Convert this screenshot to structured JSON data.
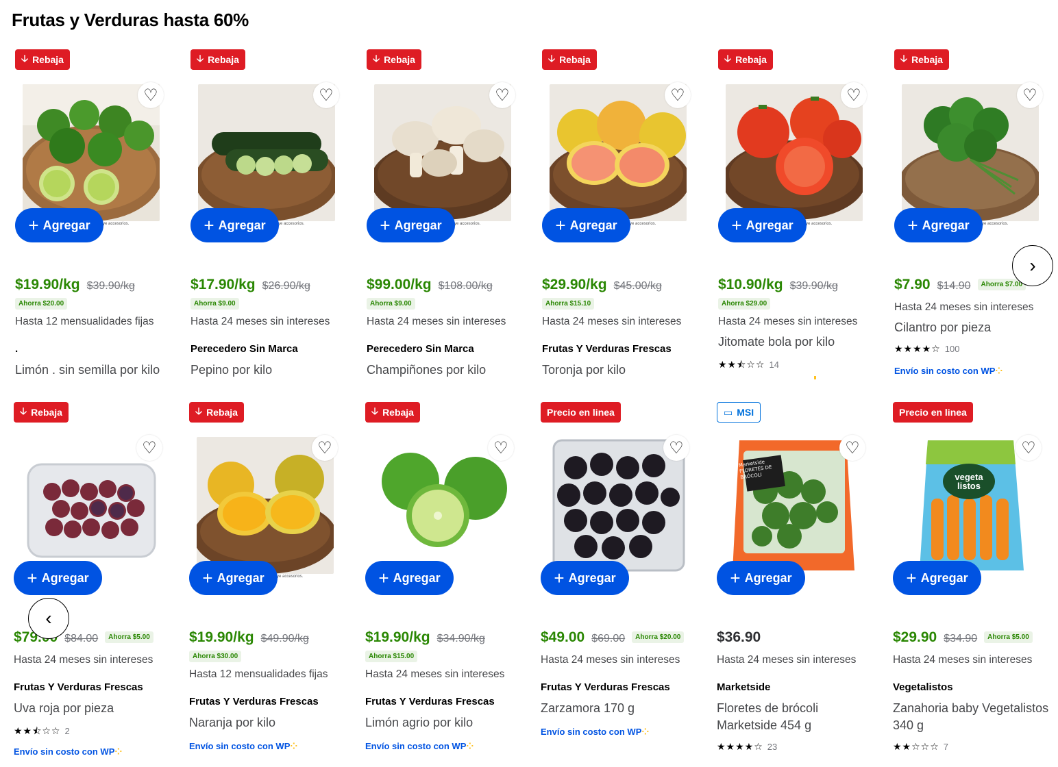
{
  "page_title": "Frutas y Verduras hasta 60%",
  "add_label": "Agregar",
  "favorite_icon": "heart-icon",
  "nav": {
    "next_icon": "chevron-right-icon",
    "prev_icon": "chevron-left-icon"
  },
  "colors": {
    "price_green": "#2a8703",
    "add_blue": "#0053e2",
    "badge_red": "#de1c24"
  },
  "img_text": "ye accesorios.",
  "row1": [
    {
      "badge": "Rebaja",
      "price": "$19.90/kg",
      "old": "$39.90/kg",
      "save": "Ahorra $20.00",
      "msi": "Hasta 12 mensualidades fijas",
      "brand": ".",
      "name": "Limón . sin semilla por kilo"
    },
    {
      "badge": "Rebaja",
      "price": "$17.90/kg",
      "old": "$26.90/kg",
      "save": "Ahorra $9.00",
      "msi": "Hasta 24 meses sin intereses",
      "brand": "Perecedero Sin Marca",
      "name": "Pepino por kilo"
    },
    {
      "badge": "Rebaja",
      "price": "$99.00/kg",
      "old": "$108.00/kg",
      "save": "Ahorra $9.00",
      "msi": "Hasta 24 meses sin intereses",
      "brand": "Perecedero Sin Marca",
      "name": "Champiñones por kilo"
    },
    {
      "badge": "Rebaja",
      "price": "$29.90/kg",
      "old": "$45.00/kg",
      "save": "Ahorra $15.10",
      "msi": "Hasta 24 meses sin intereses",
      "brand": "Frutas Y Verduras Frescas",
      "name": "Toronja por kilo"
    },
    {
      "badge": "Rebaja",
      "price": "$10.90/kg",
      "old": "$39.90/kg",
      "save": "Ahorra $29.00",
      "msi": "Hasta 24 meses sin intereses",
      "name": "Jitomate bola por kilo",
      "stars": "★★⯪☆☆",
      "rating_count": "14"
    },
    {
      "badge": "Rebaja",
      "price": "$7.90",
      "old": "$14.90",
      "save": "Ahorra $7.00",
      "msi": "Hasta 24 meses sin intereses",
      "name": "Cilantro por pieza",
      "stars": "★★★★☆",
      "rating_count": "100",
      "ship": "Envío sin costo con",
      "ship_logo": "WP"
    }
  ],
  "row2": [
    {
      "badge": "Rebaja",
      "price": "$79.00",
      "old": "$84.00",
      "save": "Ahorra $5.00",
      "msi": "Hasta 24 meses sin intereses",
      "brand": "Frutas Y Verduras Frescas",
      "name": "Uva roja por pieza",
      "stars": "★★⯪☆☆",
      "rating_count": "2",
      "ship": "Envío sin costo con",
      "ship_logo": "WP"
    },
    {
      "badge": "Rebaja",
      "price": "$19.90/kg",
      "old": "$49.90/kg",
      "save": "Ahorra $30.00",
      "msi": "Hasta 12 mensualidades fijas",
      "brand": "Frutas Y Verduras Frescas",
      "name": "Naranja por kilo",
      "ship": "Envío sin costo con",
      "ship_logo": "WP"
    },
    {
      "badge": "Rebaja",
      "price": "$19.90/kg",
      "old": "$34.90/kg",
      "save": "Ahorra $15.00",
      "msi": "Hasta 24 meses sin intereses",
      "brand": "Frutas Y Verduras Frescas",
      "name": "Limón agrio por kilo",
      "ship": "Envío sin costo con",
      "ship_logo": "WP"
    },
    {
      "badge": "Precio en linea",
      "price": "$49.00",
      "old": "$69.00",
      "save": "Ahorra $20.00",
      "msi": "Hasta 24 meses sin intereses",
      "brand": "Frutas Y Verduras Frescas",
      "name": "Zarzamora 170 g",
      "ship": "Envío sin costo con",
      "ship_logo": "WP"
    },
    {
      "badge": "MSI",
      "price": "$36.90",
      "msi": "Hasta 24 meses sin intereses",
      "brand": "Marketside",
      "name": "Floretes de brócoli Marketside 454 g",
      "stars": "★★★★☆",
      "rating_count": "23",
      "pack_text": "Marketside FLORETES DE BRÓCOLI"
    },
    {
      "badge": "Precio en linea",
      "price": "$29.90",
      "old": "$34.90",
      "save": "Ahorra $5.00",
      "msi": "Hasta 24 meses sin intereses",
      "brand": "Vegetalistos",
      "name": "Zanahoria baby Vegetalistos 340 g",
      "stars": "★★☆☆☆",
      "rating_count": "7",
      "pack_text": "vegeta listos"
    }
  ]
}
